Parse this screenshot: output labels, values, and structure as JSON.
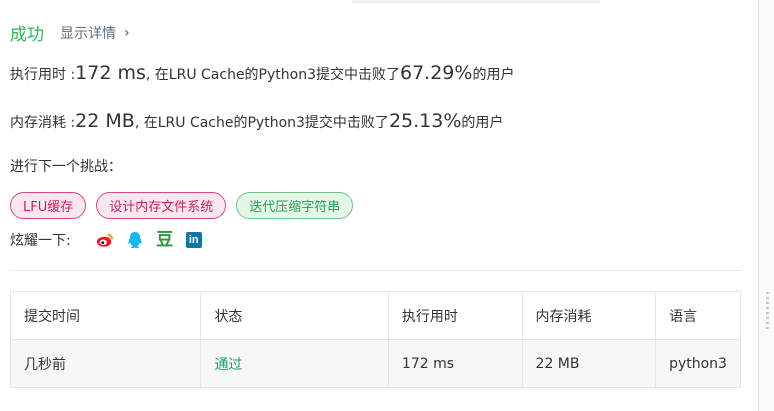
{
  "header": {
    "status": "成功",
    "details_label": "显示详情",
    "details_chevron": "›"
  },
  "runtime": {
    "label": "执行用时 : ",
    "value": "172 ms",
    "middle": ", 在LRU Cache的Python3提交中击败了",
    "percent": "67.29%",
    "suffix": " 的用户"
  },
  "memory": {
    "label": "内存消耗 : ",
    "value": "22 MB",
    "middle": ", 在LRU Cache的Python3提交中击败了",
    "percent": "25.13%",
    "suffix": " 的用户"
  },
  "challenge": {
    "label": "进行下一个挑战：",
    "tags": [
      {
        "label": "LFU缓存",
        "difficulty": "hard"
      },
      {
        "label": "设计内存文件系统",
        "difficulty": "hard"
      },
      {
        "label": "迭代压缩字符串",
        "difficulty": "easy"
      }
    ]
  },
  "share": {
    "label": "炫耀一下:",
    "icons": [
      "weibo-icon",
      "qq-icon",
      "douban-icon",
      "linkedin-icon"
    ],
    "douban_glyph": "豆",
    "linkedin_glyph": "in"
  },
  "submissions": {
    "headers": [
      "提交时间",
      "状态",
      "执行用时",
      "内存消耗",
      "语言"
    ],
    "rows": [
      {
        "time": "几秒前",
        "status": "通过",
        "runtime": "172 ms",
        "memory": "22 MB",
        "language": "python3"
      }
    ]
  },
  "colors": {
    "success": "#2db55d",
    "hard_tag_bg": "#fbe7ef",
    "hard_tag_border": "#d94a7a",
    "easy_tag_bg": "#e5f6e9",
    "easy_tag_border": "#6cc488",
    "weibo": "#e6162d",
    "qq": "#12b7f5",
    "douban": "#2e963d",
    "linkedin": "#0e76a8",
    "pass": "#1e9f6e"
  }
}
